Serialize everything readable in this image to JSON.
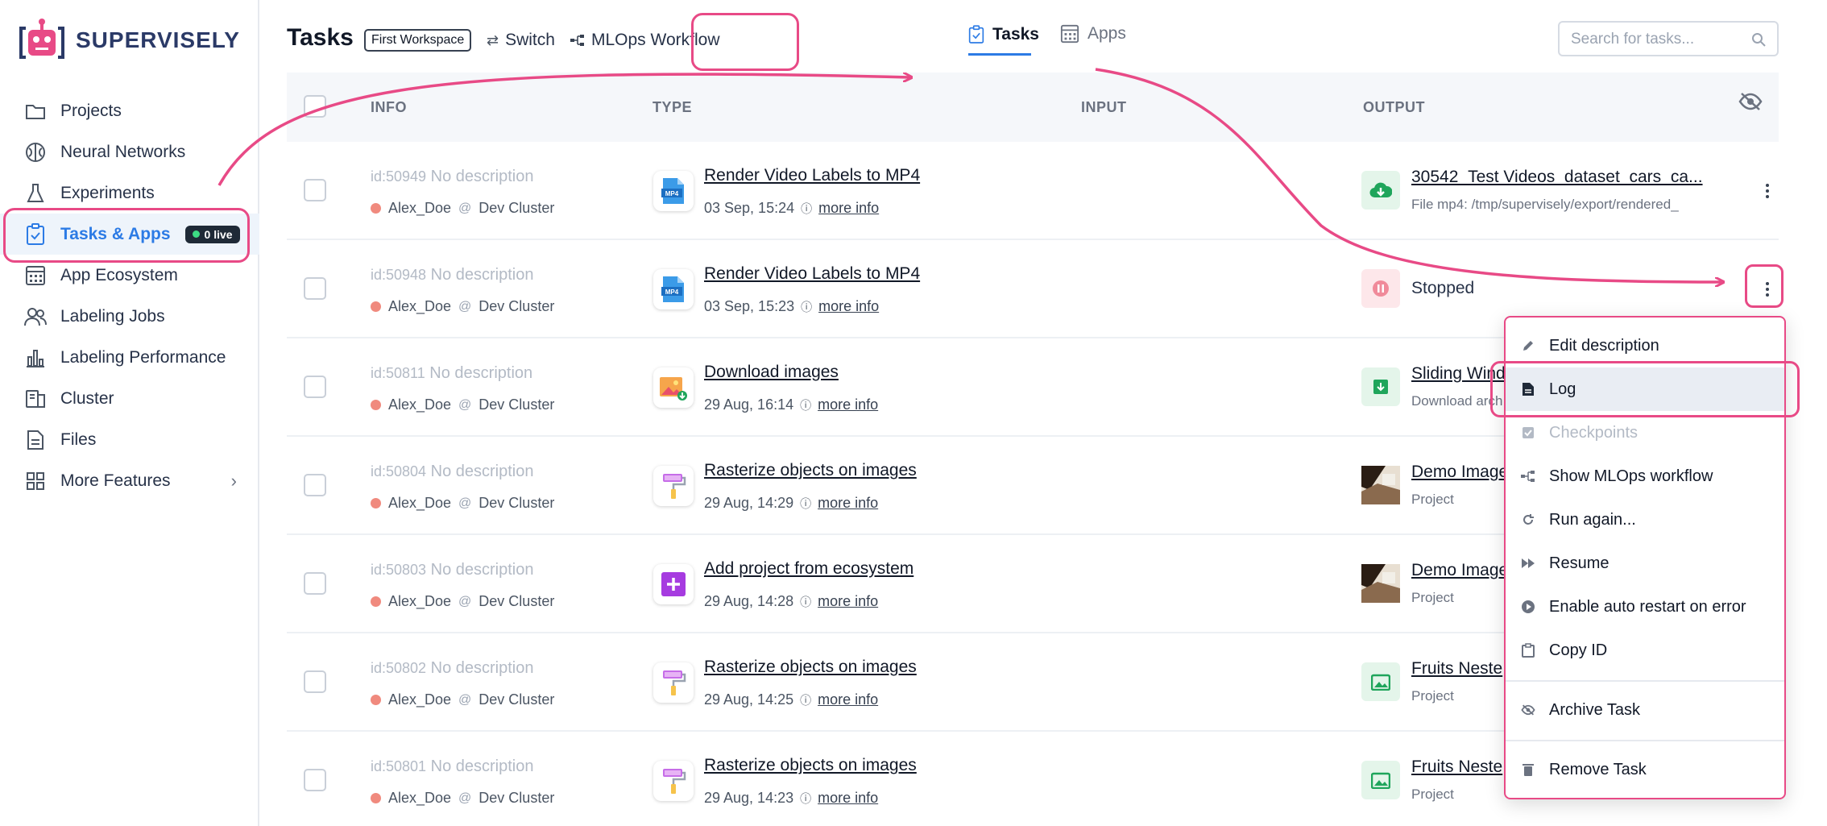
{
  "brand": {
    "name": "SUPERVISELY"
  },
  "sidebar": {
    "items": [
      {
        "label": "Projects",
        "icon": "folder-icon"
      },
      {
        "label": "Neural Networks",
        "icon": "brain-icon"
      },
      {
        "label": "Experiments",
        "icon": "flask-icon"
      },
      {
        "label": "Tasks & Apps",
        "icon": "clipboard-check-icon",
        "badge": "0 live",
        "active": true
      },
      {
        "label": "App Ecosystem",
        "icon": "app-grid-icon"
      },
      {
        "label": "Labeling Jobs",
        "icon": "users-icon"
      },
      {
        "label": "Labeling Performance",
        "icon": "bar-chart-icon"
      },
      {
        "label": "Cluster",
        "icon": "server-icon"
      },
      {
        "label": "Files",
        "icon": "file-icon"
      },
      {
        "label": "More Features",
        "icon": "grid-icon"
      }
    ]
  },
  "header": {
    "title": "Tasks",
    "workspace": "First Workspace",
    "switch_label": "Switch",
    "workflow_label": "MLOps Workflow",
    "tabs": [
      {
        "label": "Tasks"
      },
      {
        "label": "Apps"
      }
    ],
    "search_placeholder": "Search for tasks..."
  },
  "table": {
    "columns": [
      "INFO",
      "TYPE",
      "INPUT",
      "OUTPUT"
    ],
    "rows": [
      {
        "id": "id:50949",
        "desc": "No description",
        "user": "Alex_Doe",
        "cluster": "Dev Cluster",
        "name": "Render Video Labels to MP4",
        "date": "03 Sep, 15:24",
        "more": "more info",
        "out_title": "30542_Test Videos_dataset_cars_ca...",
        "out_sub": "File mp4: /tmp/supervisely/export/rendered_"
      },
      {
        "id": "id:50948",
        "desc": "No description",
        "user": "Alex_Doe",
        "cluster": "Dev Cluster",
        "name": "Render Video Labels to MP4",
        "date": "03 Sep, 15:23",
        "more": "more info",
        "out_status": "Stopped"
      },
      {
        "id": "id:50811",
        "desc": "No description",
        "user": "Alex_Doe",
        "cluster": "Dev Cluster",
        "name": "Download images",
        "date": "29 Aug, 16:14",
        "more": "more info",
        "out_title": "Sliding Wind",
        "out_sub": "Download arch"
      },
      {
        "id": "id:50804",
        "desc": "No description",
        "user": "Alex_Doe",
        "cluster": "Dev Cluster",
        "name": "Rasterize objects on images",
        "date": "29 Aug, 14:29",
        "more": "more info",
        "out_title": "Demo Image",
        "out_sub": "Project"
      },
      {
        "id": "id:50803",
        "desc": "No description",
        "user": "Alex_Doe",
        "cluster": "Dev Cluster",
        "name": "Add project from ecosystem",
        "date": "29 Aug, 14:28",
        "more": "more info",
        "out_title": "Demo Image",
        "out_sub": "Project"
      },
      {
        "id": "id:50802",
        "desc": "No description",
        "user": "Alex_Doe",
        "cluster": "Dev Cluster",
        "name": "Rasterize objects on images",
        "date": "29 Aug, 14:25",
        "more": "more info",
        "out_title": "Fruits Neste",
        "out_sub": "Project"
      },
      {
        "id": "id:50801",
        "desc": "No description",
        "user": "Alex_Doe",
        "cluster": "Dev Cluster",
        "name": "Rasterize objects on images",
        "date": "29 Aug, 14:23",
        "more": "more info",
        "out_title": "Fruits Neste",
        "out_sub": "Project"
      }
    ]
  },
  "context_menu": {
    "items": [
      {
        "label": "Edit description",
        "icon": "pencil-icon"
      },
      {
        "label": "Log",
        "icon": "document-icon",
        "highlighted": true
      },
      {
        "label": "Checkpoints",
        "icon": "checkbox-icon",
        "disabled": true
      },
      {
        "label": "Show MLOps workflow",
        "icon": "workflow-icon"
      },
      {
        "label": "Run again...",
        "icon": "refresh-icon"
      },
      {
        "label": "Resume",
        "icon": "fast-forward-icon"
      },
      {
        "label": "Enable auto restart on error",
        "icon": "play-circle-icon"
      },
      {
        "label": "Copy ID",
        "icon": "clipboard-icon"
      },
      {
        "label": "Archive Task",
        "icon": "eye-off-icon"
      },
      {
        "label": "Remove Task",
        "icon": "trash-icon"
      }
    ]
  },
  "colors": {
    "accent": "#2c7be5",
    "annotation": "#e84a86",
    "stopped": "#f08a9a",
    "success": "#1fa55b"
  }
}
